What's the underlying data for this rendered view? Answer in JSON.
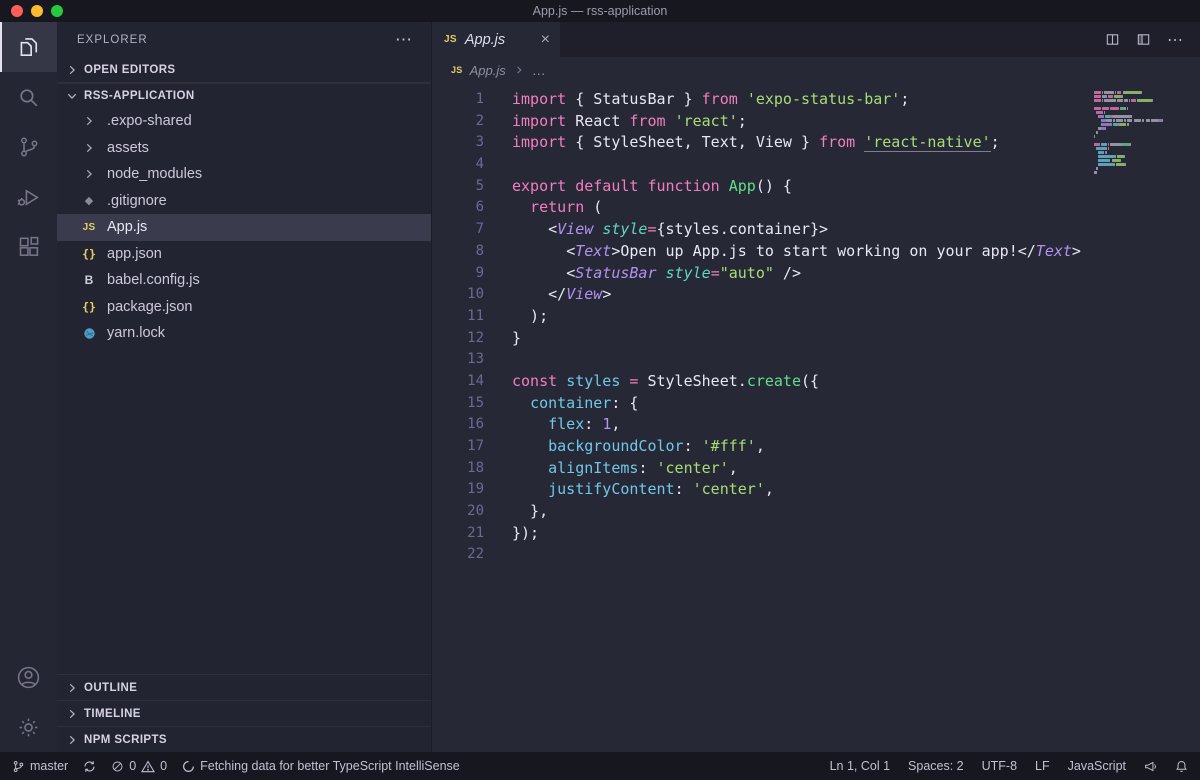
{
  "window": {
    "title": "App.js — rss-application"
  },
  "activity_bar": {
    "items": [
      "explorer",
      "search",
      "source-control",
      "run-debug",
      "extensions"
    ],
    "bottom": [
      "accounts",
      "settings"
    ]
  },
  "sidebar": {
    "title": "EXPLORER",
    "more_label": "⋯",
    "sections": {
      "open_editors": "OPEN EDITORS",
      "workspace": "RSS-APPLICATION",
      "outline": "OUTLINE",
      "timeline": "TIMELINE",
      "npm_scripts": "NPM SCRIPTS"
    },
    "tree": [
      {
        "label": ".expo-shared",
        "kind": "folder"
      },
      {
        "label": "assets",
        "kind": "folder"
      },
      {
        "label": "node_modules",
        "kind": "folder"
      },
      {
        "label": ".gitignore",
        "kind": "git"
      },
      {
        "label": "App.js",
        "kind": "js",
        "selected": true
      },
      {
        "label": "app.json",
        "kind": "json"
      },
      {
        "label": "babel.config.js",
        "kind": "babel"
      },
      {
        "label": "package.json",
        "kind": "json"
      },
      {
        "label": "yarn.lock",
        "kind": "yarn"
      }
    ]
  },
  "editor": {
    "tab": {
      "icon": "JS",
      "label": "App.js",
      "close": "×"
    },
    "tab_actions": {
      "more": "⋯"
    },
    "breadcrumb": {
      "icon": "JS",
      "file": "App.js",
      "more": "…"
    },
    "code": [
      [
        [
          "kw",
          "import "
        ],
        [
          "pun",
          "{ "
        ],
        [
          "pl",
          "StatusBar"
        ],
        [
          "pun",
          " } "
        ],
        [
          "kw",
          "from "
        ],
        [
          "str",
          "'expo-status-bar'"
        ],
        [
          "pun",
          ";"
        ]
      ],
      [
        [
          "kw",
          "import "
        ],
        [
          "pl",
          "React "
        ],
        [
          "kw",
          "from "
        ],
        [
          "str",
          "'react'"
        ],
        [
          "pun",
          ";"
        ]
      ],
      [
        [
          "kw",
          "import "
        ],
        [
          "pun",
          "{ "
        ],
        [
          "pl",
          "StyleSheet, Text, View"
        ],
        [
          "pun",
          " } "
        ],
        [
          "kw",
          "from "
        ],
        [
          "str u",
          "'react-native'"
        ],
        [
          "pun",
          ";"
        ]
      ],
      [],
      [
        [
          "kw",
          "export default function "
        ],
        [
          "fn",
          "App"
        ],
        [
          "pun",
          "() {"
        ]
      ],
      [
        [
          "pl",
          "  "
        ],
        [
          "kw",
          "return"
        ],
        [
          "pun",
          " ("
        ]
      ],
      [
        [
          "pl",
          "    "
        ],
        [
          "pun",
          "<"
        ],
        [
          "tag",
          "View"
        ],
        [
          "pl",
          " "
        ],
        [
          "attr",
          "style"
        ],
        [
          "op",
          "="
        ],
        [
          "pun",
          "{"
        ],
        [
          "pl",
          "styles.container"
        ],
        [
          "pun",
          "}>"
        ]
      ],
      [
        [
          "pl",
          "      "
        ],
        [
          "pun",
          "<"
        ],
        [
          "tag",
          "Text"
        ],
        [
          "pun",
          ">"
        ],
        [
          "pl",
          "Open up App.js to start working on your app!"
        ],
        [
          "pun",
          "</"
        ],
        [
          "tag",
          "Text"
        ],
        [
          "pun",
          ">"
        ]
      ],
      [
        [
          "pl",
          "      "
        ],
        [
          "pun",
          "<"
        ],
        [
          "tag",
          "StatusBar"
        ],
        [
          "pl",
          " "
        ],
        [
          "attr",
          "style"
        ],
        [
          "op",
          "="
        ],
        [
          "str",
          "\"auto\""
        ],
        [
          "pun",
          " />"
        ]
      ],
      [
        [
          "pl",
          "    "
        ],
        [
          "pun",
          "</"
        ],
        [
          "tag",
          "View"
        ],
        [
          "pun",
          ">"
        ]
      ],
      [
        [
          "pun",
          "  );"
        ]
      ],
      [
        [
          "pun",
          "}"
        ]
      ],
      [],
      [
        [
          "kw",
          "const "
        ],
        [
          "cv",
          "styles"
        ],
        [
          "op",
          " = "
        ],
        [
          "pl",
          "StyleSheet"
        ],
        [
          "pun",
          "."
        ],
        [
          "fn",
          "create"
        ],
        [
          "pun",
          "({"
        ]
      ],
      [
        [
          "pl",
          "  "
        ],
        [
          "cv",
          "container"
        ],
        [
          "pun",
          ": {"
        ]
      ],
      [
        [
          "pl",
          "    "
        ],
        [
          "cv",
          "flex"
        ],
        [
          "pun",
          ": "
        ],
        [
          "num",
          "1"
        ],
        [
          "pun",
          ","
        ]
      ],
      [
        [
          "pl",
          "    "
        ],
        [
          "cv",
          "backgroundColor"
        ],
        [
          "pun",
          ": "
        ],
        [
          "str",
          "'#fff'"
        ],
        [
          "pun",
          ","
        ]
      ],
      [
        [
          "pl",
          "    "
        ],
        [
          "cv",
          "alignItems"
        ],
        [
          "pun",
          ": "
        ],
        [
          "str",
          "'center'"
        ],
        [
          "pun",
          ","
        ]
      ],
      [
        [
          "pl",
          "    "
        ],
        [
          "cv",
          "justifyContent"
        ],
        [
          "pun",
          ": "
        ],
        [
          "str",
          "'center'"
        ],
        [
          "pun",
          ","
        ]
      ],
      [
        [
          "pun",
          "  },"
        ]
      ],
      [
        [
          "pun",
          "});"
        ]
      ],
      []
    ]
  },
  "status_bar": {
    "left": {
      "branch": "master",
      "errors": "0",
      "warnings": "0",
      "message": "Fetching data for better TypeScript IntelliSense"
    },
    "right": {
      "cursor": "Ln 1, Col 1",
      "indent": "Spaces: 2",
      "encoding": "UTF-8",
      "eol": "LF",
      "language": "JavaScript"
    }
  },
  "colors": {
    "keyword_pink": "#f27ebf",
    "string_green": "#a8dd76",
    "tag_purple": "#b292f0",
    "property_cyan": "#70c8e8",
    "js_yellow": "#e3cf65",
    "traffic_red": "#ff5f57",
    "traffic_yellow": "#febc2e",
    "traffic_green": "#28c840"
  }
}
